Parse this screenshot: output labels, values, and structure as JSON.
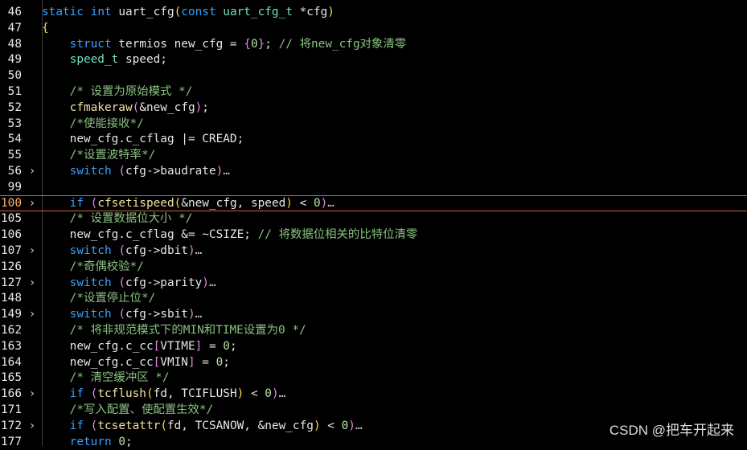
{
  "lines": [
    {
      "n": "46",
      "fold": "",
      "tokens": [
        [
          "kw",
          "static "
        ],
        [
          "kw",
          "int "
        ],
        [
          "",
          "uart_cfg"
        ],
        [
          "br1",
          "("
        ],
        [
          "kw",
          "const "
        ],
        [
          "ty",
          "uart_cfg_t "
        ],
        [
          "",
          "*cfg"
        ],
        [
          "br1",
          ")"
        ]
      ]
    },
    {
      "n": "47",
      "fold": "",
      "tokens": [
        [
          "br1",
          "{"
        ]
      ]
    },
    {
      "n": "48",
      "fold": "",
      "tokens": [
        [
          "",
          "    "
        ],
        [
          "kw",
          "struct "
        ],
        [
          "",
          "termios new_cfg = "
        ],
        [
          "br2",
          "{"
        ],
        [
          "nm",
          "0"
        ],
        [
          "br2",
          "}"
        ],
        [
          "",
          "; "
        ],
        [
          "cm",
          "// 将new_cfg对象清零"
        ]
      ]
    },
    {
      "n": "49",
      "fold": "",
      "tokens": [
        [
          "",
          "    "
        ],
        [
          "ty",
          "speed_t "
        ],
        [
          "",
          "speed;"
        ]
      ]
    },
    {
      "n": "50",
      "fold": "",
      "tokens": []
    },
    {
      "n": "51",
      "fold": "",
      "tokens": [
        [
          "",
          "    "
        ],
        [
          "cm",
          "/* 设置为原始模式 */"
        ]
      ]
    },
    {
      "n": "52",
      "fold": "",
      "tokens": [
        [
          "",
          "    "
        ],
        [
          "fn",
          "cfmakeraw"
        ],
        [
          "br2",
          "("
        ],
        [
          "",
          "&new_cfg"
        ],
        [
          "br2",
          ")"
        ],
        [
          ";",
          ";"
        ]
      ]
    },
    {
      "n": "53",
      "fold": "",
      "tokens": [
        [
          "",
          "    "
        ],
        [
          "cm",
          "/*使能接收*/"
        ]
      ]
    },
    {
      "n": "54",
      "fold": "",
      "tokens": [
        [
          "",
          "    "
        ],
        [
          "",
          "new_cfg.c_cflag |= CREAD;"
        ]
      ]
    },
    {
      "n": "55",
      "fold": "",
      "tokens": [
        [
          "",
          "    "
        ],
        [
          "cm",
          "/*设置波特率*/"
        ]
      ]
    },
    {
      "n": "56",
      "fold": ">",
      "tokens": [
        [
          "",
          "    "
        ],
        [
          "kw",
          "switch "
        ],
        [
          "br2",
          "("
        ],
        [
          "",
          "cfg->baudrate"
        ],
        [
          "br2",
          ")"
        ],
        [
          "ell",
          "…"
        ]
      ]
    },
    {
      "n": "99",
      "fold": "",
      "tokens": []
    },
    {
      "n": "100",
      "fold": ">",
      "current": true,
      "tokens": [
        [
          "",
          "    "
        ],
        [
          "kw",
          "if "
        ],
        [
          "br2",
          "("
        ],
        [
          "fn",
          "cfsetispeed"
        ],
        [
          "br1",
          "("
        ],
        [
          "",
          "&new_cfg, speed"
        ],
        [
          "br1",
          ")"
        ],
        [
          "",
          " < "
        ],
        [
          "nm",
          "0"
        ],
        [
          "br2",
          ")"
        ],
        [
          "ell",
          "…"
        ]
      ]
    },
    {
      "n": "105",
      "fold": "",
      "tokens": [
        [
          "",
          "    "
        ],
        [
          "cm",
          "/* 设置数据位大小 */"
        ]
      ]
    },
    {
      "n": "106",
      "fold": "",
      "tokens": [
        [
          "",
          "    "
        ],
        [
          "",
          "new_cfg.c_cflag &= ~CSIZE; "
        ],
        [
          "cm",
          "// 将数据位相关的比特位清零"
        ]
      ]
    },
    {
      "n": "107",
      "fold": ">",
      "tokens": [
        [
          "",
          "    "
        ],
        [
          "kw",
          "switch "
        ],
        [
          "br2",
          "("
        ],
        [
          "",
          "cfg->dbit"
        ],
        [
          "br2",
          ")"
        ],
        [
          "ell",
          "…"
        ]
      ]
    },
    {
      "n": "126",
      "fold": "",
      "tokens": [
        [
          "",
          "    "
        ],
        [
          "cm",
          "/*奇偶校验*/"
        ]
      ]
    },
    {
      "n": "127",
      "fold": ">",
      "tokens": [
        [
          "",
          "    "
        ],
        [
          "kw",
          "switch "
        ],
        [
          "br2",
          "("
        ],
        [
          "",
          "cfg->parity"
        ],
        [
          "br2",
          ")"
        ],
        [
          "ell",
          "…"
        ]
      ]
    },
    {
      "n": "148",
      "fold": "",
      "tokens": [
        [
          "",
          "    "
        ],
        [
          "cm",
          "/*设置停止位*/"
        ]
      ]
    },
    {
      "n": "149",
      "fold": ">",
      "tokens": [
        [
          "",
          "    "
        ],
        [
          "kw",
          "switch "
        ],
        [
          "br2",
          "("
        ],
        [
          "",
          "cfg->sbit"
        ],
        [
          "br2",
          ")"
        ],
        [
          "ell",
          "…"
        ]
      ]
    },
    {
      "n": "162",
      "fold": "",
      "tokens": [
        [
          "",
          "    "
        ],
        [
          "cm",
          "/* 将非规范模式下的MIN和TIME设置为0 */"
        ]
      ]
    },
    {
      "n": "163",
      "fold": "",
      "tokens": [
        [
          "",
          "    "
        ],
        [
          "",
          "new_cfg.c_cc"
        ],
        [
          "br2",
          "["
        ],
        [
          "",
          "VTIME"
        ],
        [
          "br2",
          "]"
        ],
        [
          "",
          " = "
        ],
        [
          "nm",
          "0"
        ],
        [
          "",
          ";"
        ]
      ]
    },
    {
      "n": "164",
      "fold": "",
      "tokens": [
        [
          "",
          "    "
        ],
        [
          "",
          "new_cfg.c_cc"
        ],
        [
          "br2",
          "["
        ],
        [
          "",
          "VMIN"
        ],
        [
          "br2",
          "]"
        ],
        [
          "",
          " = "
        ],
        [
          "nm",
          "0"
        ],
        [
          "",
          ";"
        ]
      ]
    },
    {
      "n": "165",
      "fold": "",
      "tokens": [
        [
          "",
          "    "
        ],
        [
          "cm",
          "/* 清空缓冲区 */"
        ]
      ]
    },
    {
      "n": "166",
      "fold": ">",
      "tokens": [
        [
          "",
          "    "
        ],
        [
          "kw",
          "if "
        ],
        [
          "br2",
          "("
        ],
        [
          "fn",
          "tcflush"
        ],
        [
          "br1",
          "("
        ],
        [
          "",
          "fd, TCIFLUSH"
        ],
        [
          "br1",
          ")"
        ],
        [
          "",
          " < "
        ],
        [
          "nm",
          "0"
        ],
        [
          "br2",
          ")"
        ],
        [
          "ell",
          "…"
        ]
      ]
    },
    {
      "n": "171",
      "fold": "",
      "tokens": [
        [
          "",
          "    "
        ],
        [
          "cm",
          "/*写入配置、使配置生效*/"
        ]
      ]
    },
    {
      "n": "172",
      "fold": ">",
      "tokens": [
        [
          "",
          "    "
        ],
        [
          "kw",
          "if "
        ],
        [
          "br2",
          "("
        ],
        [
          "fn",
          "tcsetattr"
        ],
        [
          "br1",
          "("
        ],
        [
          "",
          "fd, TCSANOW, &new_cfg"
        ],
        [
          "br1",
          ")"
        ],
        [
          "",
          " < "
        ],
        [
          "nm",
          "0"
        ],
        [
          "br2",
          ")"
        ],
        [
          "ell",
          "…"
        ]
      ]
    },
    {
      "n": "177",
      "fold": "",
      "tokens": [
        [
          "",
          "    "
        ],
        [
          "kw",
          "return "
        ],
        [
          "nm",
          "0"
        ],
        [
          "",
          ";"
        ]
      ]
    }
  ],
  "watermark": "CSDN @把车开起来"
}
